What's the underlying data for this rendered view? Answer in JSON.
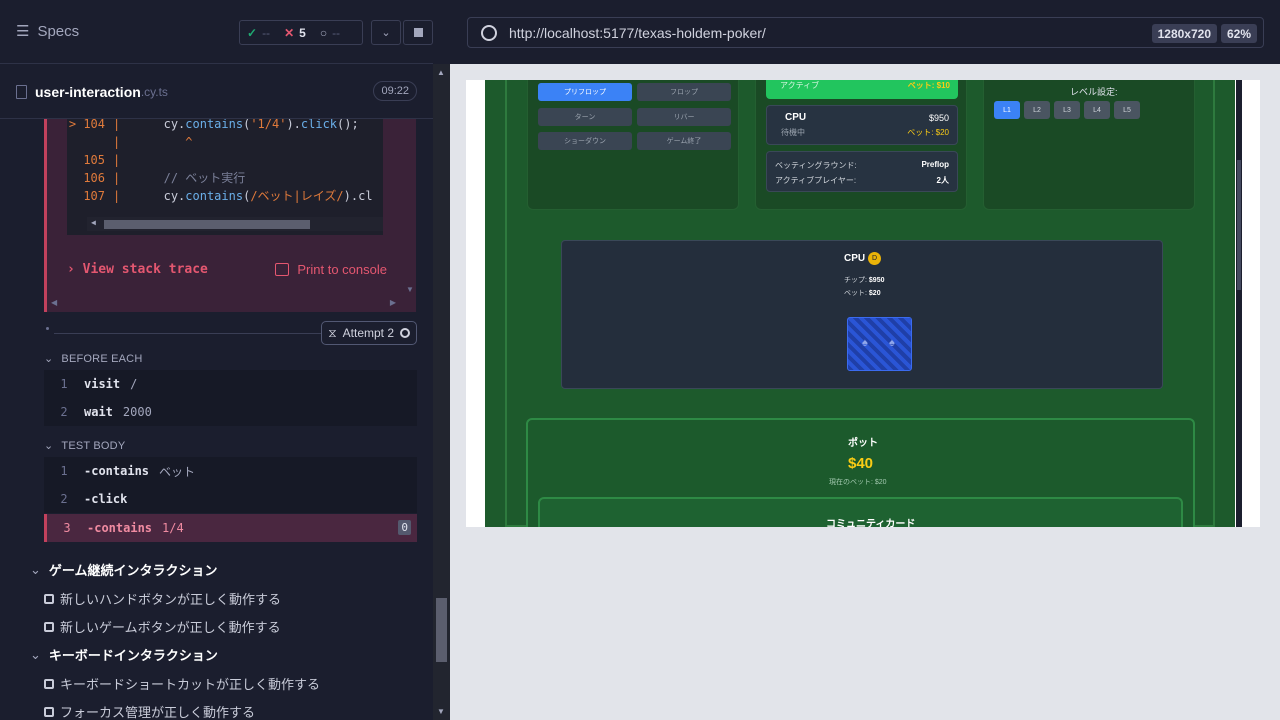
{
  "header": {
    "specs_label": "Specs",
    "pass_count": "--",
    "fail_count": "5",
    "pending_count": "--"
  },
  "spec_file": {
    "name": "user-interaction",
    "ext": ".cy.ts",
    "time": "09:22"
  },
  "error": {
    "code_lines": [
      {
        "num": "104",
        "marker": ">",
        "content_fn": "cy.",
        "content_call": "contains",
        "content_rest": "(",
        "content_str": "'1/4'",
        "content_tail": ").",
        "content_call2": "click",
        "content_end": "();"
      },
      {
        "num": "",
        "marker": "",
        "caret": "^"
      },
      {
        "num": "105",
        "marker": ""
      },
      {
        "num": "106",
        "marker": "",
        "comment": "// ベット実行"
      },
      {
        "num": "107",
        "marker": "",
        "content_fn": "cy.",
        "content_call": "contains",
        "content_rest": "(",
        "content_str": "/ベット|レイズ/",
        "content_tail": ").cl"
      }
    ],
    "view_stack_trace": "View stack trace",
    "print_to_console": "Print to console"
  },
  "attempt": {
    "label": "Attempt 2"
  },
  "before_each": {
    "title": "BEFORE EACH",
    "commands": [
      {
        "num": "1",
        "name": "visit",
        "arg": "/"
      },
      {
        "num": "2",
        "name": "wait",
        "arg": "2000"
      }
    ]
  },
  "test_body": {
    "title": "TEST BODY",
    "commands": [
      {
        "num": "1",
        "name": "-contains",
        "arg": "ベット"
      },
      {
        "num": "2",
        "name": "-click",
        "arg": ""
      },
      {
        "num": "3",
        "name": "-contains",
        "arg": "1/4",
        "badge": "0"
      }
    ]
  },
  "suites": [
    {
      "title": "ゲーム継続インタラクション",
      "tests": [
        "新しいハンドボタンが正しく動作する",
        "新しいゲームボタンが正しく動作する"
      ]
    },
    {
      "title": "キーボードインタラクション",
      "tests": [
        "キーボードショートカットが正しく動作する",
        "フォーカス管理が正しく動作する"
      ]
    }
  ],
  "browser": {
    "url": "http://localhost:5177/texas-holdem-poker/",
    "viewport": "1280x720",
    "zoom": "62%"
  },
  "app": {
    "stage_buttons": [
      "プリフロップ",
      "フロップ",
      "ターン",
      "リバー",
      "ショーダウン",
      "ゲーム終了"
    ],
    "active_label": "アクティブ",
    "active_bet": "ベット: $10",
    "cpu_name": "CPU",
    "cpu_status": "待機中",
    "cpu_chips": "$950",
    "cpu_bet": "ベット: $20",
    "betting_round_label": "ベッティングラウンド:",
    "betting_round_value": "Preflop",
    "active_players_label": "アクティブプレイヤー:",
    "active_players_value": "2人",
    "level_title": "レベル設定:",
    "levels": [
      "L1",
      "L2",
      "L3",
      "L4",
      "L5"
    ],
    "opponent_name": "CPU",
    "dealer_badge": "D",
    "opponent_chips_label": "チップ:",
    "opponent_chips": "$950",
    "opponent_bet_label": "ベット:",
    "opponent_bet": "$20",
    "pot_title": "ポット",
    "pot_amount": "$40",
    "current_bet": "現在のベット: $20",
    "community_title": "コミュニティカード"
  },
  "colors": {
    "fail": "#e45770",
    "pass": "#1fa971",
    "accent": "#3b82f6"
  }
}
